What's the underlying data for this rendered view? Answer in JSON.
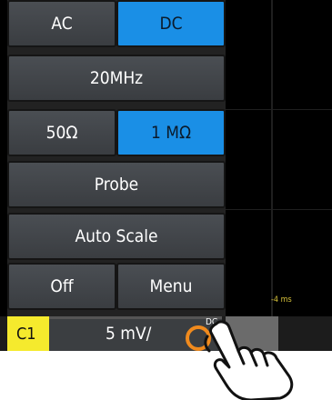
{
  "menu": {
    "coupling_ac": "AC",
    "coupling_dc": "DC",
    "bandwidth": "20MHz",
    "impedance_50": "50Ω",
    "impedance_1m": "1 MΩ",
    "probe": "Probe",
    "auto_scale": "Auto Scale",
    "off": "Off",
    "menu": "Menu"
  },
  "time_label": "-4 ms",
  "channel": {
    "name": "C1",
    "scale": "5 mV/",
    "coupling": "DC"
  },
  "colors": {
    "active": "#1a8fe6",
    "channel_yellow": "#f5ea2d",
    "knob_orange": "#f08a1d"
  }
}
